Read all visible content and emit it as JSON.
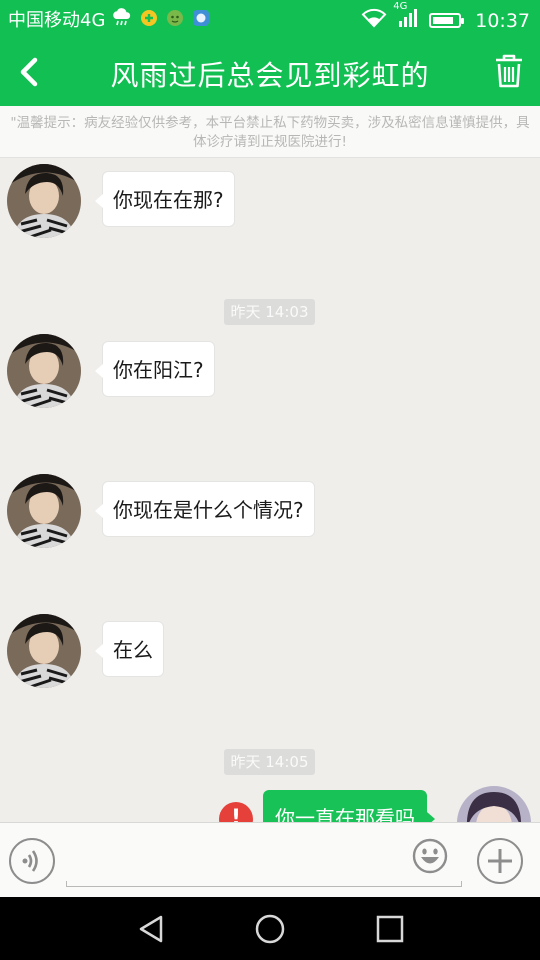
{
  "status_bar": {
    "carrier": "中国移动4G",
    "network_badge": "4G",
    "time": "10:37",
    "battery_level": 0.85,
    "icons": [
      "cloud-rain-icon",
      "app-notification-icon",
      "app-notification-icon",
      "app-notification-icon",
      "wifi-icon",
      "signal-icon",
      "battery-icon"
    ]
  },
  "header": {
    "title": "风雨过后总会见到彩虹的",
    "back_icon": "chevron-left-icon",
    "delete_icon": "trash-icon",
    "color": "#12bf53"
  },
  "notice": {
    "text": "\"温馨提示：病友经验仅供参考，本平台禁止私下药物买卖，涉及私密信息谨慎提供，具体诊疗请到正规医院进行!"
  },
  "messages": [
    {
      "type": "incoming",
      "text": "你现在在那?"
    },
    {
      "type": "timestamp",
      "text": "昨天 14:03"
    },
    {
      "type": "incoming",
      "text": "你在阳江?"
    },
    {
      "type": "incoming",
      "text": "你现在是什么个情况?"
    },
    {
      "type": "incoming",
      "text": "在么"
    },
    {
      "type": "timestamp",
      "text": "昨天 14:05"
    },
    {
      "type": "outgoing",
      "text": "你一直在那看吗",
      "status": "failed"
    }
  ],
  "input_bar": {
    "voice_icon": "voice-icon",
    "emoji_icon": "emoji-icon",
    "add_icon": "plus-icon"
  },
  "nav_bar": {
    "icons": [
      "back-triangle-icon",
      "home-circle-icon",
      "recents-square-icon"
    ]
  },
  "colors": {
    "accent": "#12bf53",
    "outgoing_bubble": "#19c257",
    "error": "#e5403a",
    "background": "#efeeeb"
  }
}
